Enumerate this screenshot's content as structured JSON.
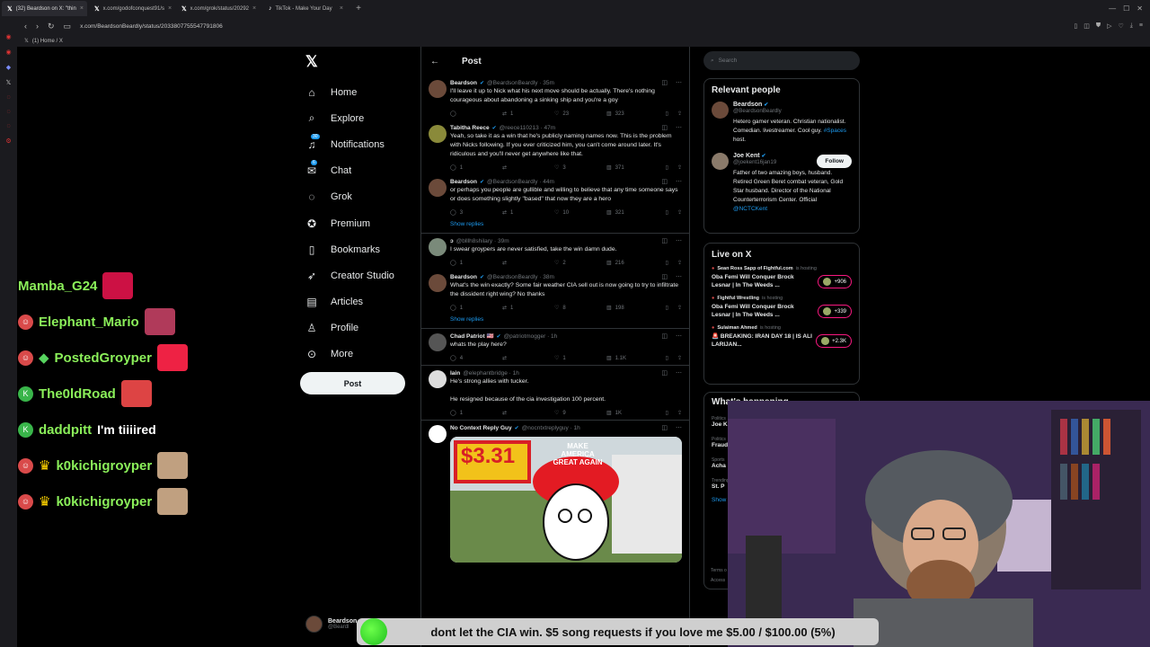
{
  "browser": {
    "tabs": [
      {
        "label": "(32) Beardson on X: \"thin",
        "active": true
      },
      {
        "label": "x.com/godofconquest91/s",
        "active": false
      },
      {
        "label": "x.com/grok/status/20292",
        "active": false
      },
      {
        "label": "TikTok - Make Your Day",
        "active": false
      }
    ],
    "url": "x.com/BeardsonBeardly/status/2033807755547791806",
    "bookmark": "(1) Home / X"
  },
  "x_nav": {
    "items": [
      {
        "label": "Home",
        "icon": "home-icon",
        "glyph": "⌂"
      },
      {
        "label": "Explore",
        "icon": "search-icon",
        "glyph": "⌕"
      },
      {
        "label": "Notifications",
        "icon": "bell-icon",
        "glyph": "♫",
        "badge": "30"
      },
      {
        "label": "Chat",
        "icon": "mail-icon",
        "glyph": "✉",
        "badge": "6"
      },
      {
        "label": "Grok",
        "icon": "grok-icon",
        "glyph": "◌"
      },
      {
        "label": "Premium",
        "icon": "premium-icon",
        "glyph": "✪"
      },
      {
        "label": "Bookmarks",
        "icon": "bookmark-icon",
        "glyph": "▯"
      },
      {
        "label": "Creator Studio",
        "icon": "rocket-icon",
        "glyph": "➶"
      },
      {
        "label": "Articles",
        "icon": "article-icon",
        "glyph": "▤"
      },
      {
        "label": "Profile",
        "icon": "person-icon",
        "glyph": "♙"
      },
      {
        "label": "More",
        "icon": "more-icon",
        "glyph": "⊙"
      }
    ],
    "post_label": "Post",
    "account": {
      "name": "Beardson",
      "handle": "@Beardl"
    }
  },
  "main": {
    "title": "Post",
    "show_replies": "Show replies",
    "tweets": [
      {
        "name": "Beardson",
        "handle": "@BeardsonBeardly · 35m",
        "text": "I'll leave it up to Nick what his next move should be actually. There's nothing courageous about abandoning a sinking ship and you're a goy",
        "reply": "",
        "rt": "1",
        "like": "23",
        "views": "323",
        "color": "#6b4a3a"
      },
      {
        "name": "Tabitha Reece",
        "handle": "@reece110213 · 47m",
        "text": "Yeah, so take it as a win that he's publicly naming names now. This is the problem with Nicks following. If you ever criticized him, you can't come around later. It's ridiculous and you'll never get anywhere like that.",
        "reply": "1",
        "rt": "",
        "like": "3",
        "views": "371",
        "color": "#8a8a3a"
      },
      {
        "name": "Beardson",
        "handle": "@BeardsonBeardly · 44m",
        "text": "or perhaps you people are gullible and willing to believe that any time someone says or does something slightly \"based\" that now they are a hero",
        "reply": "3",
        "rt": "1",
        "like": "10",
        "views": "321",
        "color": "#6b4a3a"
      },
      {
        "name": "ɔ",
        "handle": "@blllh8shilary · 39m",
        "text": "I swear groypers are never satisfied, take the win damn dude.",
        "reply": "1",
        "rt": "",
        "like": "2",
        "views": "216",
        "color": "#7a8a7a"
      },
      {
        "name": "Beardson",
        "handle": "@BeardsonBeardly · 38m",
        "text": "What's the win exactly? Some fair weather  CIA sell out is now going to try to infiltrate the dissident right wing? No thanks",
        "reply": "1",
        "rt": "1",
        "like": "8",
        "views": "198",
        "color": "#6b4a3a"
      },
      {
        "name": "Chad Patriot 🇺🇸",
        "handle": "@patriotmogger · 1h",
        "text": "whats the play here?",
        "reply": "4",
        "rt": "",
        "like": "1",
        "views": "1.1K",
        "color": "#555"
      },
      {
        "name": "Iain",
        "handle": "@elephantbridge · 1h",
        "text": "He's strong allies with tucker.",
        "text2": "He resigned because of the cia investigation 100 percent.",
        "reply": "1",
        "rt": "",
        "like": "9",
        "views": "1K",
        "color": "#ddd"
      },
      {
        "name": "No Context Reply Guy",
        "handle": "@nocntxtreplyguy · 1h",
        "text": "",
        "color": "#fff"
      }
    ],
    "meme": {
      "price": "$3.31",
      "cap": "MAKE AMERICA GREAT AGAIN"
    }
  },
  "right": {
    "search_placeholder": "Search",
    "relevant_title": "Relevant people",
    "people": [
      {
        "name": "Beardson",
        "handle": "@BeardsonBeardly",
        "bio": "Hetero gamer veteran. Christian nationalist. Comedian. livestreamer. Cool guy.",
        "bio_link": "#Spaces",
        "bio_tail": "host."
      },
      {
        "name": "Joe Kent",
        "handle": "@joekent16jan19",
        "bio": "Father of two amazing boys, husband. Retired Green Beret combat veteran, Gold Star husband. Director of the National Counterterrorism Center. Official",
        "bio_link": "@NCTCKent",
        "bio_tail": "",
        "follow": "Follow"
      }
    ],
    "live_title": "Live on X",
    "live": [
      {
        "host": "Sean Ross Sapp of Fightful.com",
        "status": "is hosting",
        "title": "Oba Femi Will Conquer Brock Lesnar | In The Weeds ...",
        "count": "+906"
      },
      {
        "host": "Fightful Wrestling",
        "status": "is hosting",
        "title": "Oba Femi Will Conquer Brock Lesnar | In The Weeds ...",
        "count": "+339"
      },
      {
        "host": "Sulaiman Ahmed",
        "status": "is hosting",
        "title": "🚨 BREAKING: IRAN DAY 18 | IS ALI LARIJAN...",
        "count": "+2.3K"
      }
    ],
    "trends_title": "What's happening",
    "trends": [
      {
        "cat": "Politics",
        "name": "Joe K"
      },
      {
        "cat": "Politics",
        "name": "Fraud"
      },
      {
        "cat": "Sports",
        "name": "Acha"
      },
      {
        "cat": "Trending",
        "name": "St. P"
      }
    ],
    "show_more": "Show",
    "terms": [
      "Terms o",
      "Access"
    ]
  },
  "chat": [
    {
      "name": "Mamba_G24",
      "body": "",
      "badge": "",
      "emote": "#cc1144"
    },
    {
      "name": "Elephant_Mario",
      "body": "",
      "badge": "avatar",
      "emote": "#b03a5a"
    },
    {
      "name": "PostedGroyper",
      "body": "",
      "badge": "avatar",
      "emote": "#ee2244"
    },
    {
      "name": "The0ldRoad",
      "body": "",
      "badge": "green",
      "emote": "#dd4444"
    },
    {
      "name": "daddpitt",
      "body": "I'm tiiiired",
      "badge": "green",
      "emote": ""
    },
    {
      "name": "k0kichigroyper",
      "body": "",
      "badge": "crown",
      "emote": "#c0a080"
    },
    {
      "name": "k0kichigroyper",
      "body": "",
      "badge": "crown",
      "emote": "#c0a080"
    }
  ],
  "banner": {
    "text": "dont let the CIA win. $5 song requests if you love me $5.00 / $100.00 (5%)"
  }
}
